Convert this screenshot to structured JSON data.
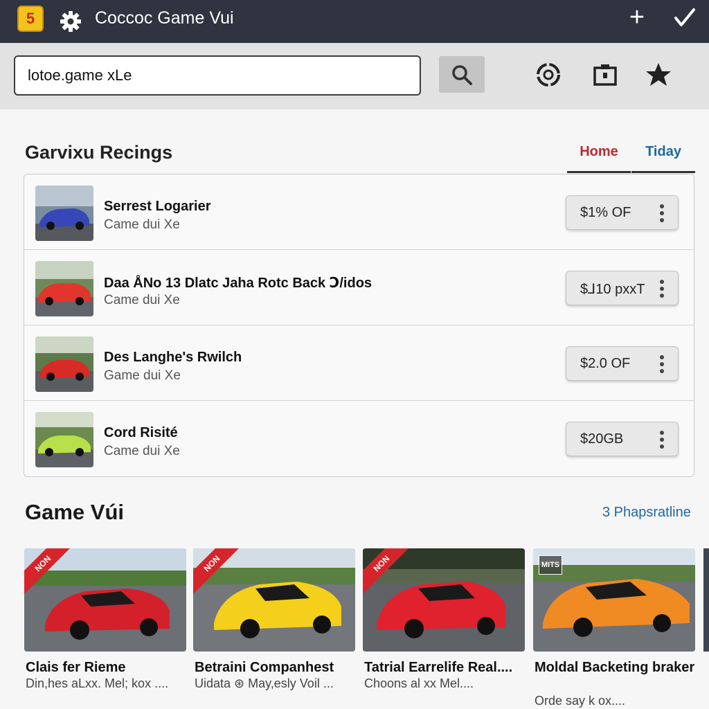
{
  "app": {
    "title": "Coccoc Game Vui",
    "logo_text": "5",
    "icons": {
      "settings": "gear-icon",
      "add": "plus-icon",
      "confirm": "check-icon"
    }
  },
  "toolbar": {
    "url_value": "lotoe.game xLe",
    "search_icon": "search-icon",
    "icons": [
      "refresh-icon",
      "camera-icon",
      "star-icon"
    ]
  },
  "section": {
    "title": "Garvixu Recings",
    "tabs": [
      {
        "label": "Home",
        "color": "#c0282d"
      },
      {
        "label": "Tiday",
        "color": "#1e67a3"
      }
    ]
  },
  "list": [
    {
      "title": "Serrest Logarier",
      "subtitle": "Came dui  Xe",
      "price": "$1% OF",
      "thumb_car": "#3747b8"
    },
    {
      "title": "Daa ÅNo 13 Dlatc Jaha Rotc Back Ↄ/idos",
      "subtitle": "Came dui  Xe",
      "price": "$⅃10 pxxT",
      "thumb_car": "#e0362e"
    },
    {
      "title": "Des Langhe's Rwilch",
      "subtitle": "Game dui  Xe",
      "price": "$2.0 OF",
      "thumb_car": "#d92b25"
    },
    {
      "title": "Cord Risité",
      "subtitle": "Came dui  Xe",
      "price": "$20GB",
      "thumb_car": "#b8e04a"
    }
  ],
  "games_section": {
    "title": "Game Vúi",
    "link": "3 Phapsratline"
  },
  "cards": [
    {
      "badge": "NON",
      "title": "Clais fer Rieme",
      "subtitle": "Din,hes aLxx. Mel; kox ....",
      "car_color": "#d4202a"
    },
    {
      "badge": "NON",
      "title": "Betraini Companhest",
      "subtitle": "Uidata ⊛ May,esly Voil ...",
      "car_color": "#f4cf1c"
    },
    {
      "badge": "NON",
      "title": "Tatrial Earrelife Real....",
      "subtitle": "Choons al xx Mel....",
      "car_color": "#e0222e"
    },
    {
      "badge": "MITS",
      "title": "Moldal Backeting braker",
      "subtitle": "Orde say k ox....",
      "car_color": "#f08a22"
    }
  ],
  "colors": {
    "titlebar": "#2f3440",
    "accent_red": "#c0282d",
    "accent_blue": "#1e67a3"
  }
}
